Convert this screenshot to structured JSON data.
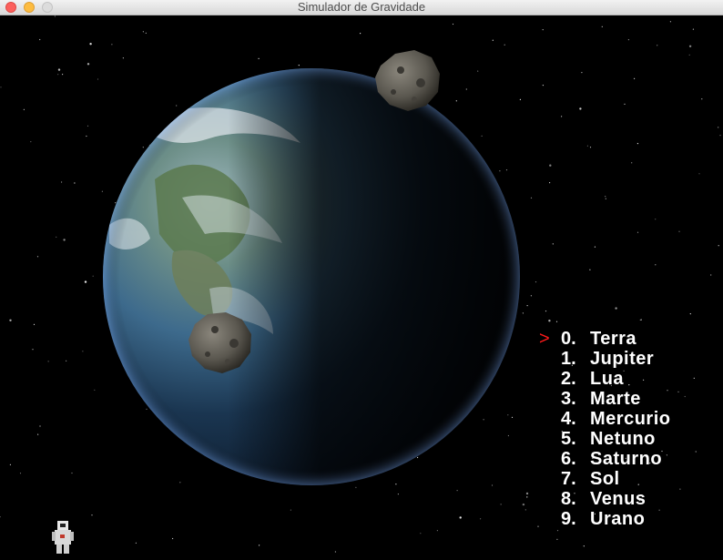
{
  "window": {
    "title": "Simulador de Gravidade"
  },
  "scene": {
    "planet": "earth",
    "objects": [
      "asteroid",
      "asteroid",
      "astronaut"
    ]
  },
  "menu": {
    "selected_index": 0,
    "marker": ">",
    "items": [
      {
        "index": "0.",
        "name": "Terra"
      },
      {
        "index": "1.",
        "name": "Jupiter"
      },
      {
        "index": "2.",
        "name": "Lua"
      },
      {
        "index": "3.",
        "name": "Marte"
      },
      {
        "index": "4.",
        "name": "Mercurio"
      },
      {
        "index": "5.",
        "name": "Netuno"
      },
      {
        "index": "6.",
        "name": "Saturno"
      },
      {
        "index": "7.",
        "name": "Sol"
      },
      {
        "index": "8.",
        "name": "Venus"
      },
      {
        "index": "9.",
        "name": "Urano"
      }
    ]
  },
  "colors": {
    "marker": "#ff1a1a",
    "menu_text": "#ffffff",
    "background": "#000000"
  }
}
